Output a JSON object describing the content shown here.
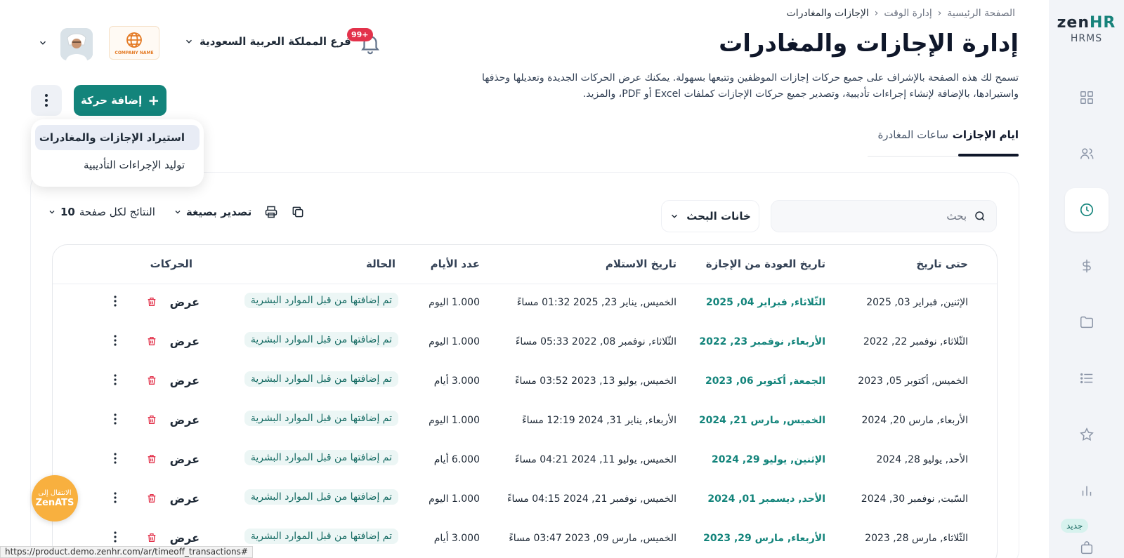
{
  "sidebar": {
    "brand": "zen",
    "brand_accent": "HR",
    "subtitle": "HRMS",
    "new_badge": "جديد",
    "icons": [
      "grid-icon",
      "people-icon",
      "clock-icon",
      "dollar-icon",
      "folder-icon",
      "list-icon",
      "star-icon",
      "chart-icon",
      "bag-icon"
    ],
    "active_icon": "clock-icon"
  },
  "breadcrumb": {
    "home": "الصفحة الرئيسية",
    "section": "إدارة الوقت",
    "current": "الإجازات والمغادرات"
  },
  "page": {
    "title": "إدارة الإجازات والمغادرات",
    "description": "تسمح لك هذه الصفحة بالإشراف على جميع حركات إجازات الموظفين وتتبعها بسهولة. يمكنك عرض الحركات الجديدة وتعديلها وحذفها واستيرادها، بالإضافة لإنشاء إجراءات تأديبية، وتصدير جميع حركات الإجازات كملفات Excel أو PDF، والمزيد."
  },
  "header": {
    "notifications": "99+",
    "branch": "فرع المملكة العربية السعودية",
    "company_logo_text": "COMPANY NAME"
  },
  "actions": {
    "add": "إضافة حركة",
    "menu": [
      "استيراد الإجازات والمغادرات",
      "توليد الإجراءات التأديبية"
    ]
  },
  "tabs": [
    "ايام الإجازات",
    "ساعات المغادرة"
  ],
  "toolbar": {
    "search_placeholder": "بحث",
    "search_fields": "خانات البحث",
    "export": "تصدير بصيغة",
    "per_page_label": "النتائج لكل صفحة",
    "per_page_value": "10"
  },
  "table": {
    "headers": [
      "حتى تاريخ",
      "تاريخ العودة من الإجازة",
      "تاريخ الاستلام",
      "عدد الأيام",
      "الحالة",
      "الحركات"
    ],
    "view_label": "عرض",
    "rows": [
      {
        "until": "الإثنين, فبراير 03, 2025",
        "return": "الثّلاثاء, فبراير 04, 2025",
        "received": "الخميس, يناير 23, 2025 01:32 مساءً",
        "days": "1.000 اليوم",
        "status": "تم إضافتها من قبل الموارد البشرية"
      },
      {
        "until": "الثّلاثاء, نوفمبر 22, 2022",
        "return": "الأربعاء, نوفمبر 23, 2022",
        "received": "الثّلاثاء, نوفمبر 08, 2022 05:33 مساءً",
        "days": "1.000 اليوم",
        "status": "تم إضافتها من قبل الموارد البشرية"
      },
      {
        "until": "الخميس, أكتوبر 05, 2023",
        "return": "الجمعة, أكتوبر 06, 2023",
        "received": "الخميس, يوليو 13, 2023 03:52 مساءً",
        "days": "3.000 أيام",
        "status": "تم إضافتها من قبل الموارد البشرية"
      },
      {
        "until": "الأربعاء, مارس 20, 2024",
        "return": "الخميس, مارس 21, 2024",
        "received": "الأربعاء, يناير 31, 2024 12:19 مساءً",
        "days": "1.000 اليوم",
        "status": "تم إضافتها من قبل الموارد البشرية"
      },
      {
        "until": "الأحد, يوليو 28, 2024",
        "return": "الإثنين, يوليو 29, 2024",
        "received": "الخميس, يوليو 11, 2024 04:21 مساءً",
        "days": "6.000 أيام",
        "status": "تم إضافتها من قبل الموارد البشرية"
      },
      {
        "until": "السّبت, نوفمبر 30, 2024",
        "return": "الأحد, ديسمبر 01, 2024",
        "received": "الخميس, نوفمبر 21, 2024 04:15 مساءً",
        "days": "1.000 اليوم",
        "status": "تم إضافتها من قبل الموارد البشرية"
      },
      {
        "until": "الثّلاثاء, مارس 28, 2023",
        "return": "الأربعاء, مارس 29, 2023",
        "received": "الخميس, مارس 09, 2023 03:47 مساءً",
        "days": "3.000 أيام",
        "status": "تم إضافتها من قبل الموارد البشرية"
      }
    ]
  },
  "zenats": {
    "line1": "الانتقال إلى",
    "line2": "ZenATS"
  },
  "status_url": "https://product.demo.zenhr.com/ar/timeoff_transactions#",
  "colors": {
    "accent": "#13847b",
    "danger": "#e3324b",
    "sidebar": "#f2f4f8",
    "zenats": "#f8b03f"
  }
}
